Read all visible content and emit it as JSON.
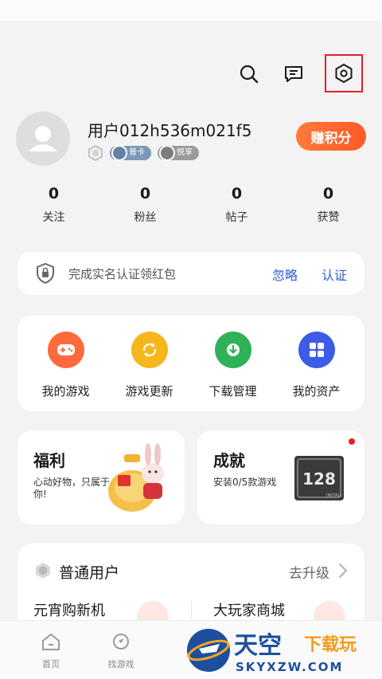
{
  "profile": {
    "username": "用户012h536m021f5",
    "badge_card": "普卡",
    "badge_share": "悦享",
    "earn_points": "赚积分"
  },
  "stats": [
    {
      "value": "0",
      "label": "关注"
    },
    {
      "value": "0",
      "label": "粉丝"
    },
    {
      "value": "0",
      "label": "帖子"
    },
    {
      "value": "0",
      "label": "获赞"
    }
  ],
  "verify": {
    "text": "完成实名认证领红包",
    "ignore": "忽略",
    "auth": "认证"
  },
  "tools": [
    {
      "label": "我的游戏",
      "color": "#ff6a3d"
    },
    {
      "label": "游戏更新",
      "color": "#f6b71c"
    },
    {
      "label": "下载管理",
      "color": "#2fb158"
    },
    {
      "label": "我的资产",
      "color": "#3d5ce6"
    }
  ],
  "welfare": {
    "title": "福利",
    "subtitle": "心动好物，只属于你!"
  },
  "achievement": {
    "title": "成就",
    "subtitle": "安装0/5款游戏",
    "badge_number": "128",
    "badge_caption": "INSTALL"
  },
  "vip": {
    "title": "普通用户",
    "upgrade": "去升级",
    "item1": "元宵购新机",
    "item2": "大玩家商城"
  },
  "nav": {
    "home": "首页",
    "find_games": "找游戏"
  },
  "watermark": {
    "brand": "天空",
    "tag": "下载玩",
    "domain": "SKYXZW.COM"
  }
}
